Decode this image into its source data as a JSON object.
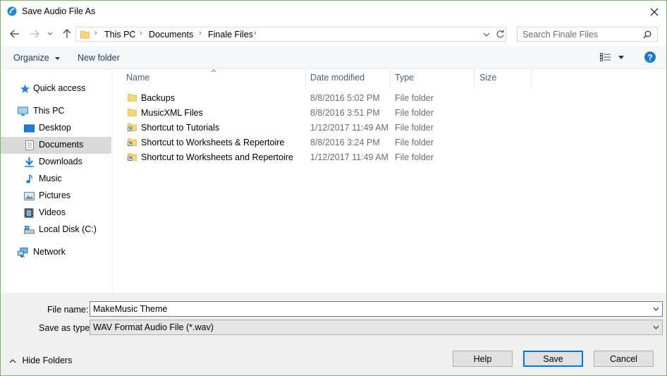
{
  "window": {
    "title": "Save Audio File As"
  },
  "address": {
    "crumbs": [
      "This PC",
      "Documents",
      "Finale Files"
    ],
    "search_placeholder": "Search Finale Files"
  },
  "toolbar": {
    "organize": "Organize",
    "new_folder": "New folder"
  },
  "nav": {
    "quick_access": "Quick access",
    "this_pc": "This PC",
    "desktop": "Desktop",
    "documents": "Documents",
    "downloads": "Downloads",
    "music": "Music",
    "pictures": "Pictures",
    "videos": "Videos",
    "local_disk": "Local Disk (C:)",
    "network": "Network"
  },
  "columns": {
    "name": "Name",
    "date": "Date modified",
    "type": "Type",
    "size": "Size"
  },
  "files": [
    {
      "name": "Backups",
      "date": "8/8/2016 5:02 PM",
      "type": "File folder",
      "icon": "folder-icon"
    },
    {
      "name": "MusicXML Files",
      "date": "8/8/2016 3:51 PM",
      "type": "File folder",
      "icon": "folder-icon"
    },
    {
      "name": "Shortcut to Tutorials",
      "date": "1/12/2017 11:49 AM",
      "type": "File folder",
      "icon": "shortcut-folder-icon"
    },
    {
      "name": "Shortcut to Worksheets & Repertoire",
      "date": "8/8/2016 3:24 PM",
      "type": "File folder",
      "icon": "shortcut-folder-icon"
    },
    {
      "name": "Shortcut to Worksheets and Repertoire",
      "date": "1/12/2017 11:49 AM",
      "type": "File folder",
      "icon": "shortcut-folder-icon"
    }
  ],
  "form": {
    "file_name_label": "File name:",
    "file_name_value": "MakeMusic Theme",
    "save_type_label": "Save as type:",
    "save_type_value": "WAV Format Audio File (*.wav)"
  },
  "buttons": {
    "hide_folders": "Hide Folders",
    "help": "Help",
    "save": "Save",
    "cancel": "Cancel"
  },
  "colors": {
    "accent": "#0078d7",
    "folder": "#f8d775",
    "help": "#1979ca"
  }
}
